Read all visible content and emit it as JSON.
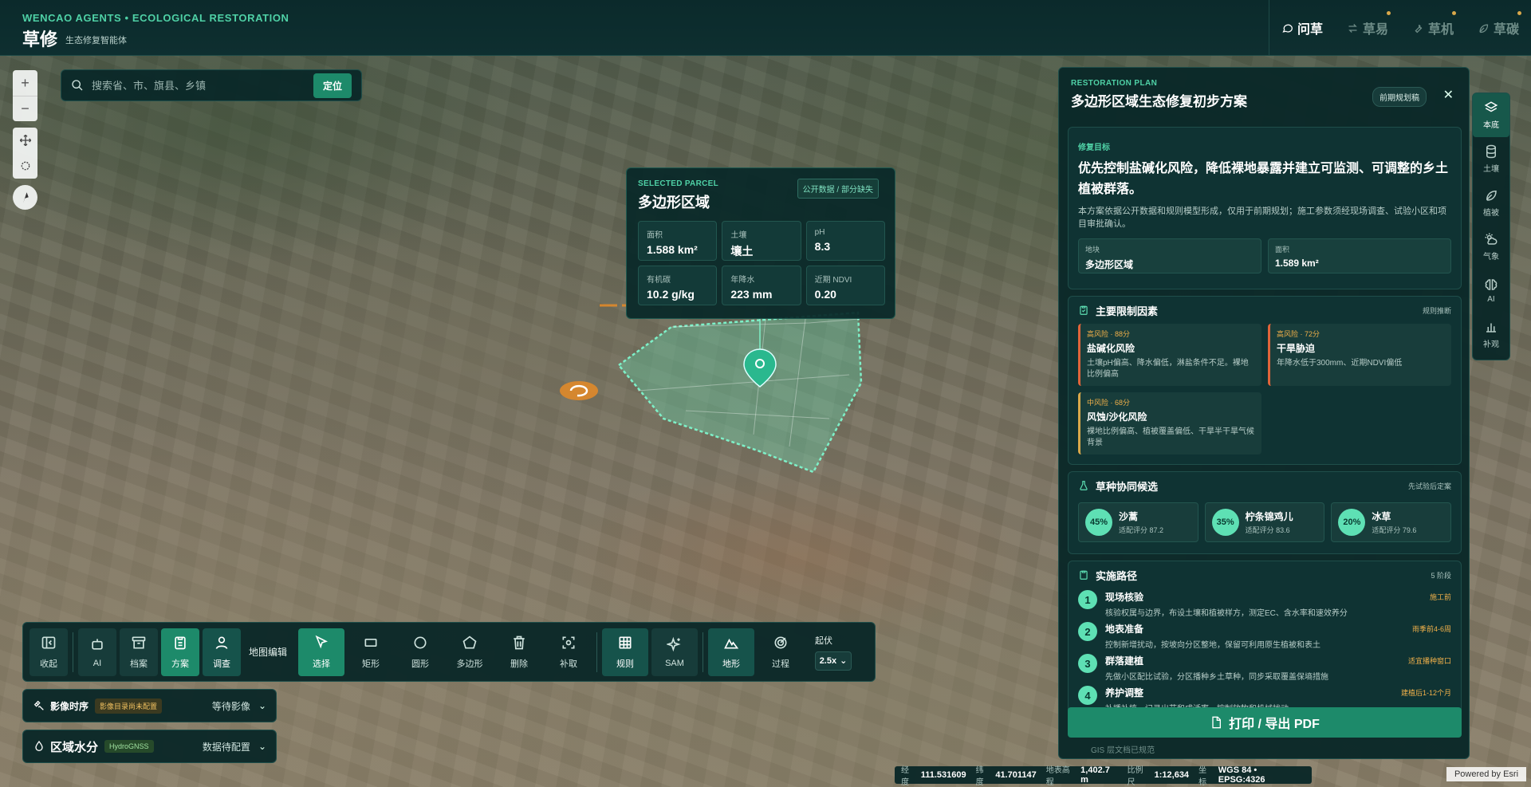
{
  "header": {
    "kicker": "WENCAO AGENTS • ECOLOGICAL RESTORATION",
    "title": "草修",
    "subtitle": "生态修复智能体",
    "nav": [
      {
        "label": "问草",
        "icon": "chat-icon",
        "active": true
      },
      {
        "label": "草易",
        "icon": "swap-icon",
        "active": false
      },
      {
        "label": "草机",
        "icon": "wrench-icon",
        "active": false
      },
      {
        "label": "草碳",
        "icon": "leaf-icon",
        "active": false
      }
    ]
  },
  "search": {
    "placeholder": "搜索省、市、旗县、乡镇",
    "button": "定位"
  },
  "parcel": {
    "kicker": "SELECTED PARCEL",
    "title": "多边形区域",
    "tag": "公开数据 / 部分缺失",
    "metrics": [
      {
        "label": "面积",
        "value": "1.588 km²"
      },
      {
        "label": "土壤",
        "value": "壤土"
      },
      {
        "label": "pH",
        "value": "8.3"
      },
      {
        "label": "有机碳",
        "value": "10.2 g/kg"
      },
      {
        "label": "年降水",
        "value": "223 mm"
      },
      {
        "label": "近期 NDVI",
        "value": "0.20"
      }
    ]
  },
  "plan": {
    "kicker": "RESTORATION PLAN",
    "title": "多边形区域生态修复初步方案",
    "stage": "前期规划稿",
    "goal": {
      "kicker": "修复目标",
      "headline": "优先控制盐碱化风险，降低裸地暴露并建立可监测、可调整的乡土植被群落。",
      "description": "本方案依据公开数据和规则模型形成，仅用于前期规划；施工参数须经现场调查、试验小区和项目审批确认。",
      "stats": [
        {
          "label": "地块",
          "value": "多边形区域"
        },
        {
          "label": "面积",
          "value": "1.589 km²"
        }
      ]
    },
    "factors": {
      "title": "主要限制因素",
      "side": "规则推断",
      "items": [
        {
          "level": "高风险 · 88分",
          "name": "盐碱化风险",
          "desc": "土壤pH偏高、降水偏低，淋盐条件不足。裸地比例偏高",
          "tone": "high"
        },
        {
          "level": "高风险 · 72分",
          "name": "干旱胁迫",
          "desc": "年降水低于300mm、近期NDVI偏低",
          "tone": "high"
        },
        {
          "level": "中风险 · 68分",
          "name": "风蚀/沙化风险",
          "desc": "裸地比例偏高、植被覆盖偏低、干旱半干旱气候背景",
          "tone": "mid"
        }
      ]
    },
    "species": {
      "title": "草种协同候选",
      "side": "先试验后定案",
      "items": [
        {
          "pct": "45%",
          "name": "沙蒿",
          "score": "适配评分 87.2"
        },
        {
          "pct": "35%",
          "name": "柠条锦鸡儿",
          "score": "适配评分 83.6"
        },
        {
          "pct": "20%",
          "name": "冰草",
          "score": "适配评分 79.6"
        }
      ]
    },
    "path": {
      "title": "实施路径",
      "side": "5 阶段",
      "steps": [
        {
          "num": "1",
          "name": "现场核验",
          "desc": "核验权属与边界，布设土壤和植被样方，测定EC、含水率和速效养分",
          "when": "施工前"
        },
        {
          "num": "2",
          "name": "地表准备",
          "desc": "控制新增扰动，按坡向分区整地，保留可利用原生植被和表土",
          "when": "雨季前4-6周"
        },
        {
          "num": "3",
          "name": "群落建植",
          "desc": "先做小区配比试验，分区播种乡土草种，同步采取覆盖保墒措施",
          "when": "适宜播种窗口"
        },
        {
          "num": "4",
          "name": "养护调整",
          "desc": "补播补植，记录出苗和成活率，控制放牧和机械扰动",
          "when": "建植后1-12个月"
        }
      ]
    },
    "export": "打印 / 导出 PDF",
    "footer": "GIS 层文档已规范"
  },
  "rail": [
    {
      "label": "本底",
      "icon": "layers-icon",
      "active": true
    },
    {
      "label": "土壤",
      "icon": "database-icon",
      "active": false
    },
    {
      "label": "植被",
      "icon": "leaf-icon",
      "active": false
    },
    {
      "label": "气象",
      "icon": "weather-icon",
      "active": false
    },
    {
      "label": "AI",
      "icon": "brain-icon",
      "active": false
    },
    {
      "label": "补观",
      "icon": "chart-icon",
      "active": false
    }
  ],
  "toolbar": {
    "collapse": "收起",
    "ai": "AI",
    "archive": "档案",
    "plan": "方案",
    "survey": "调查",
    "map_edit": "地图编辑",
    "select": "选择",
    "rect": "矩形",
    "circle": "圆形",
    "polygon": "多边形",
    "delete": "删除",
    "capture": "补取",
    "rules": "规则",
    "sam": "SAM",
    "terrain": "地形",
    "process": "过程",
    "relief_label": "起伏",
    "relief_value": "2.5x"
  },
  "imagery": {
    "title": "影像时序",
    "pill": "影像目录尚未配置",
    "state": "等待影像"
  },
  "hydro": {
    "title": "区域水分",
    "pill": "HydroGNSS",
    "state": "数据待配置"
  },
  "coords": {
    "lon_label": "经度",
    "lon": "111.531609",
    "lat_label": "纬度",
    "lat": "41.701147",
    "alt_label": "地表高程",
    "alt": "1,402.7 m",
    "scale_label": "比例尺",
    "scale": "1:12,634",
    "crs_label": "坐标",
    "crs": "WGS 84 • EPSG:4326"
  },
  "attribution": "Powered by Esri",
  "colors": {
    "accent": "#1d8a6a",
    "mint": "#5ee0b4",
    "panel": "#0a2828",
    "risk_high": "#e0643a",
    "risk_mid": "#d9a84a"
  }
}
